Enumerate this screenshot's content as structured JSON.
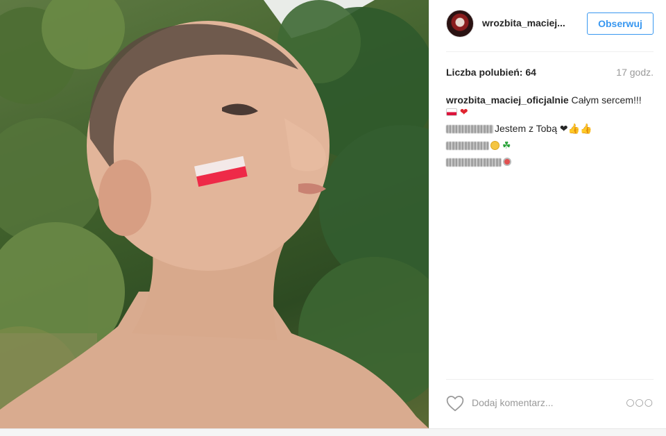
{
  "post": {
    "username": "wrozbita_maciej...",
    "follow_label": "Obserwuj",
    "likes_label": "Liczba polubień: 64",
    "time_label": "17 godz.",
    "comments": [
      {
        "user": "wrozbita_maciej_oficjalnie",
        "text": "Całym sercem!!!"
      },
      {
        "user": "",
        "text": "Jestem z Tobą"
      },
      {
        "user": "",
        "text": ""
      },
      {
        "user": "",
        "text": ""
      }
    ],
    "add_comment_placeholder": "Dodaj komentarz...",
    "more_label": "○○○"
  },
  "photo": {
    "subject": "shirtless man with Polish flag painted on cheek, green hedge background"
  },
  "icons": {
    "avatar": "profile-avatar",
    "like": "heart-outline-icon",
    "more": "more-options-icon"
  },
  "colors": {
    "accent": "#3897f0",
    "muted": "#999999",
    "flag_white": "#f5f5f5",
    "flag_red": "#e8223a"
  }
}
